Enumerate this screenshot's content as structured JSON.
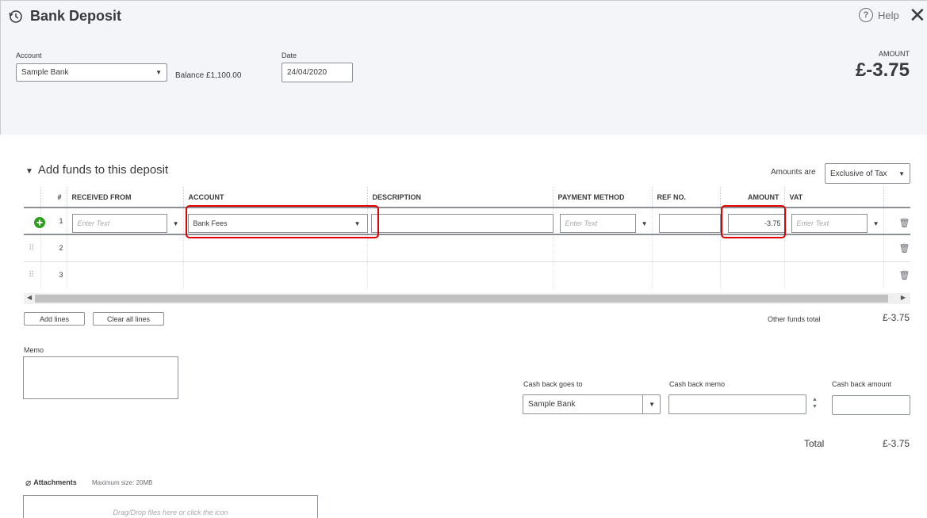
{
  "header": {
    "title": "Bank Deposit",
    "help_label": "Help",
    "account_label": "Account",
    "account_value": "Sample Bank",
    "balance_text": "Balance £1,100.00",
    "date_label": "Date",
    "date_value": "24/04/2020",
    "amount_label": "AMOUNT",
    "amount_value": "£-3.75"
  },
  "section": {
    "title": "Add funds to this deposit",
    "amounts_are_label": "Amounts are",
    "amounts_are_value": "Exclusive of Tax"
  },
  "columns": [
    "#",
    "RECEIVED FROM",
    "ACCOUNT",
    "DESCRIPTION",
    "PAYMENT METHOD",
    "REF NO.",
    "AMOUNT",
    "VAT"
  ],
  "rows": [
    {
      "num": "1",
      "received_from_placeholder": "Enter Text",
      "account": "Bank Fees",
      "payment_placeholder": "Enter Text",
      "amount": "-3.75",
      "vat_placeholder": "Enter Text"
    },
    {
      "num": "2"
    },
    {
      "num": "3"
    }
  ],
  "buttons": {
    "add_lines": "Add lines",
    "clear_all_lines": "Clear all lines"
  },
  "other_funds": {
    "label": "Other funds total",
    "value": "£-3.75"
  },
  "memo_label": "Memo",
  "cash_back": {
    "goes_to_label": "Cash back goes to",
    "goes_to_value": "Sample Bank",
    "memo_label": "Cash back memo",
    "amount_label": "Cash back amount"
  },
  "total": {
    "label": "Total",
    "value": "£-3.75"
  },
  "attachments": {
    "label": "Attachments",
    "max_size": "Maximum size: 20MB",
    "drop_text": "Drag/Drop files here or click the icon"
  },
  "colors": {
    "accent_red": "#e00000",
    "add_green": "#2ca01c",
    "header_bg": "#f4f5f8"
  }
}
